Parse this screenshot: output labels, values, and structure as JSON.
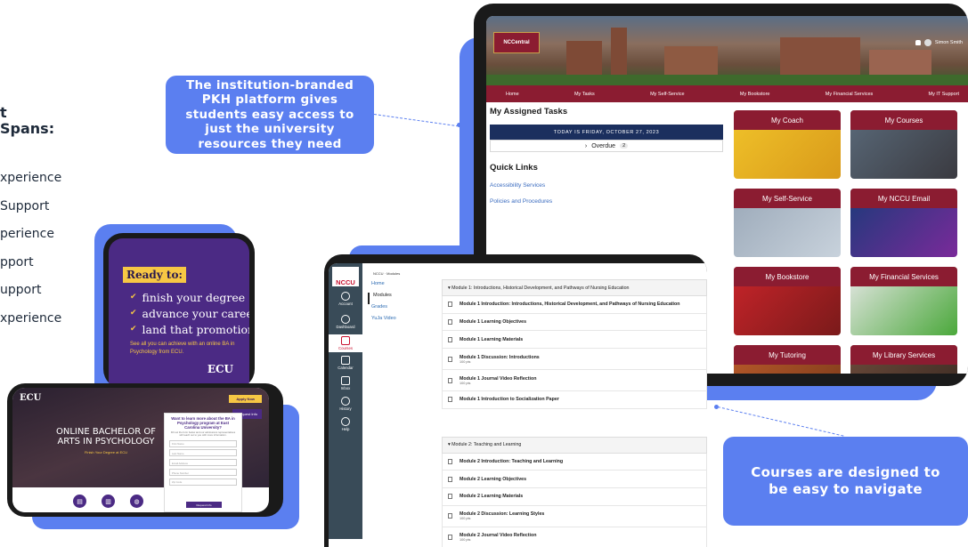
{
  "left_text": {
    "heading": "t\nSpans:",
    "items": [
      "xperience",
      "Support",
      "perience",
      "pport",
      "upport",
      "xperience"
    ]
  },
  "callouts": {
    "top": "The institution-branded PKH platform gives students easy access to just the university resources they need",
    "bottom": "Courses are designed to be easy to navigate"
  },
  "portal": {
    "logo": "NCCentral",
    "user": "Simon Smith",
    "nav": [
      "Home",
      "My Tasks",
      "My Self-Service",
      "My Bookstore",
      "My Financial Services",
      "My IT Support"
    ],
    "assigned_title": "My Assigned Tasks",
    "today": "TODAY IS FRIDAY, OCTOBER 27, 2023",
    "overdue_label": "Overdue",
    "overdue_count": "2",
    "quick_links_title": "Quick Links",
    "quick_links": [
      "Accessibility Services",
      "Policies and Procedures"
    ],
    "tiles": [
      "My Coach",
      "My Courses",
      "My Self-Service",
      "My NCCU Email",
      "My Bookstore",
      "My Financial Services",
      "My Tutoring",
      "My Library Services"
    ]
  },
  "promo_phone": {
    "title": "Ready to:",
    "items": [
      "finish your degree",
      "advance your career",
      "land that promotion"
    ],
    "desc": "See all you can achieve with an online BA in Psychology from ECU.",
    "logo": "ECU"
  },
  "ecu_phone": {
    "logo": "ECU",
    "apply": "Apply Now",
    "request": "Request Info",
    "hero_title": "ONLINE BACHELOR OF ARTS IN PSYCHOLOGY",
    "hero_sub": "Finish Your Degree at ECU",
    "form_title": "Want to learn more about the BA in Psychology program at East Carolina University?",
    "form_desc": "Fill out the form below and our admissions representatives will reach out to you with more information.",
    "fields": [
      "First Name",
      "Last Name",
      "Email Address",
      "Phone Number",
      "Zip Code"
    ],
    "submit": "Request Info"
  },
  "canvas": {
    "logo": "NCCU",
    "breadcrumb": "NCCU · Modules",
    "global_nav": [
      "Account",
      "Dashboard",
      "Courses",
      "Calendar",
      "Inbox",
      "History",
      "Help"
    ],
    "course_nav": [
      "Home",
      "Modules",
      "Grades",
      "YuJa Video"
    ],
    "module1_title": "Module 1: Introductions, Historical Development, and Pathways of Nursing Education",
    "module1_items": [
      {
        "title": "Module 1 Introduction: Introductions, Historical Development, and Pathways of Nursing Education",
        "pts": ""
      },
      {
        "title": "Module 1 Learning Objectives",
        "pts": ""
      },
      {
        "title": "Module 1 Learning Materials",
        "pts": ""
      },
      {
        "title": "Module 1 Discussion: Introductions",
        "pts": "100 pts"
      },
      {
        "title": "Module 1 Journal Video Reflection",
        "pts": "100 pts"
      },
      {
        "title": "Module 1 Introduction to Socialization Paper",
        "pts": ""
      }
    ],
    "module2_title": "Module 2: Teaching and Learning",
    "module2_items": [
      {
        "title": "Module 2 Introduction: Teaching and Learning",
        "pts": ""
      },
      {
        "title": "Module 2 Learning Objectives",
        "pts": ""
      },
      {
        "title": "Module 2 Learning Materials",
        "pts": ""
      },
      {
        "title": "Module 2 Discussion: Learning Styles",
        "pts": "100 pts"
      },
      {
        "title": "Module 2 Journal Video Reflection",
        "pts": "100 pts"
      }
    ]
  },
  "colors": {
    "accent_blue": "#5b7ff0",
    "nccu_maroon": "#8b1c31",
    "ecu_purple": "#4b2a84",
    "ecu_gold": "#f7c744"
  }
}
